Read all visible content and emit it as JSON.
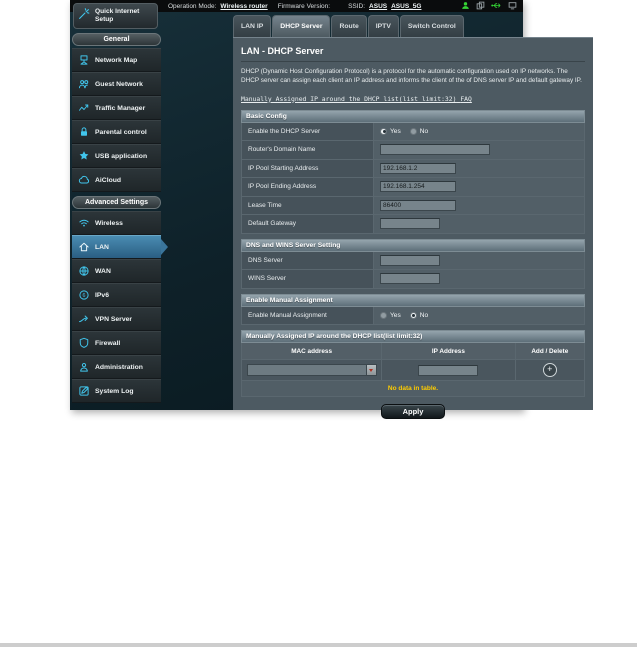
{
  "topbar": {
    "operation_mode_label": "Operation Mode:",
    "operation_mode_value": "Wireless router",
    "firmware_label": "Firmware Version:",
    "firmware_value": "",
    "ssid_label": "SSID:",
    "ssid_main": "ASUS",
    "ssid_5g": "ASUS_5G",
    "icons": [
      "client-status-icon",
      "copy-icon",
      "usb-icon",
      "monitor-icon"
    ]
  },
  "sidebar": {
    "qis_label": "Quick Internet Setup",
    "general": {
      "title": "General",
      "items": [
        {
          "label": "Network Map",
          "icon": "network-map-icon"
        },
        {
          "label": "Guest Network",
          "icon": "guest-network-icon"
        },
        {
          "label": "Traffic Manager",
          "icon": "traffic-manager-icon"
        },
        {
          "label": "Parental control",
          "icon": "parental-control-icon"
        },
        {
          "label": "USB application",
          "icon": "usb-application-icon"
        },
        {
          "label": "AiCloud",
          "icon": "aicloud-icon"
        }
      ]
    },
    "advanced": {
      "title": "Advanced Settings",
      "items": [
        {
          "label": "Wireless",
          "icon": "wireless-icon",
          "active": false
        },
        {
          "label": "LAN",
          "icon": "lan-icon",
          "active": true
        },
        {
          "label": "WAN",
          "icon": "wan-icon",
          "active": false
        },
        {
          "label": "IPv6",
          "icon": "ipv6-icon",
          "active": false
        },
        {
          "label": "VPN Server",
          "icon": "vpn-server-icon",
          "active": false
        },
        {
          "label": "Firewall",
          "icon": "firewall-icon",
          "active": false
        },
        {
          "label": "Administration",
          "icon": "administration-icon",
          "active": false
        },
        {
          "label": "System Log",
          "icon": "system-log-icon",
          "active": false
        }
      ]
    }
  },
  "tabs": [
    {
      "label": "LAN IP",
      "active": false
    },
    {
      "label": "DHCP Server",
      "active": true
    },
    {
      "label": "Route",
      "active": false
    },
    {
      "label": "IPTV",
      "active": false
    },
    {
      "label": "Switch Control",
      "active": false
    }
  ],
  "page": {
    "title": "LAN - DHCP Server",
    "description": "DHCP (Dynamic Host Configuration Protocol) is a protocol for the automatic configuration used on IP networks. The DHCP server can assign each client an IP address and informs the client of the of DNS server IP and default gateway IP.",
    "link_text": "Manually Assigned IP around the DHCP list(list limit:32)",
    "faq_label": "FAQ"
  },
  "basic_config": {
    "title": "Basic Config",
    "enable_dhcp": {
      "label": "Enable the DHCP Server",
      "yes": "Yes",
      "no": "No",
      "selected": "Yes"
    },
    "domain": {
      "label": "Router's Domain Name",
      "value": ""
    },
    "pool_start": {
      "label": "IP Pool Starting Address",
      "value": "192.168.1.2"
    },
    "pool_end": {
      "label": "IP Pool Ending Address",
      "value": "192.168.1.254"
    },
    "lease": {
      "label": "Lease Time",
      "value": "86400"
    },
    "gateway": {
      "label": "Default Gateway",
      "value": ""
    }
  },
  "dns_wins": {
    "title": "DNS and WINS Server Setting",
    "dns": {
      "label": "DNS Server",
      "value": ""
    },
    "wins": {
      "label": "WINS Server",
      "value": ""
    }
  },
  "manual_assignment": {
    "title": "Enable Manual Assignment",
    "label": "Enable Manual Assignment",
    "yes": "Yes",
    "no": "No",
    "selected": "No"
  },
  "manual_table": {
    "title": "Manually Assigned IP around the DHCP list(list limit:32)",
    "columns": [
      "MAC address",
      "IP Address",
      "Add / Delete"
    ],
    "mac_value": "",
    "ip_value": "",
    "add_symbol": "+",
    "empty_text": "No data in table."
  },
  "apply_label": "Apply",
  "colors": {
    "accent_cyan": "#41c5ec",
    "active_item_blue": "#3a759b",
    "warning_yellow": "#fecc00"
  }
}
